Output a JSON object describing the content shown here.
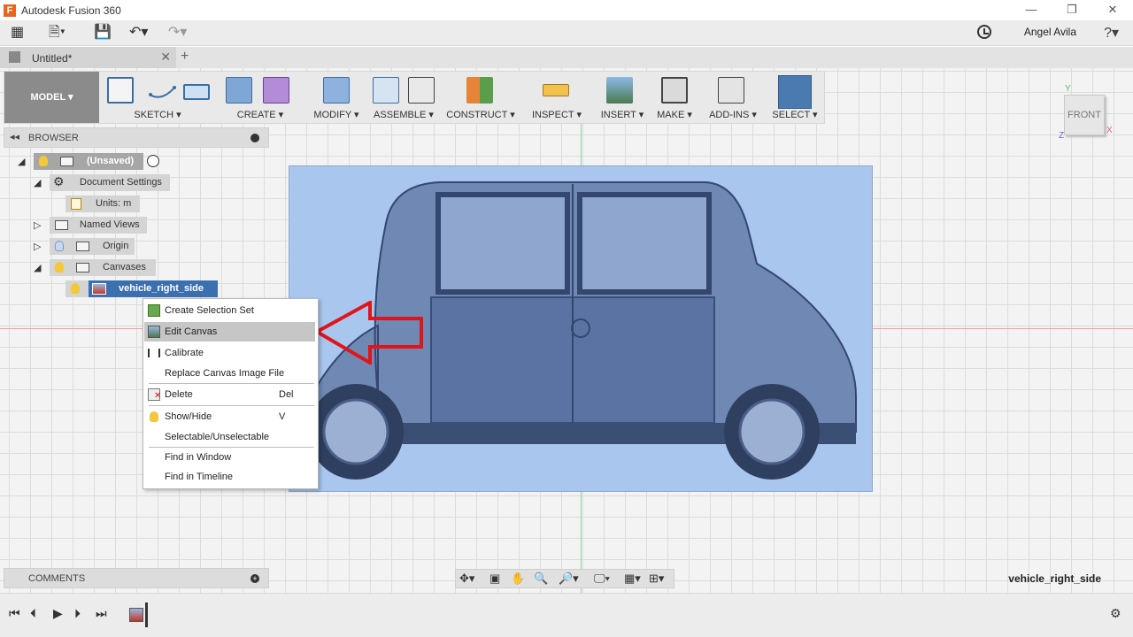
{
  "window": {
    "app_title": "Autodesk Fusion 360",
    "logo": "F"
  },
  "quick_access": {
    "user": "Angel Avila"
  },
  "tabs": {
    "doc_tab": "Untitled*"
  },
  "toolbar": {
    "model": "MODEL",
    "groups": [
      "SKETCH",
      "CREATE",
      "MODIFY",
      "ASSEMBLE",
      "CONSTRUCT",
      "INSPECT",
      "INSERT",
      "MAKE",
      "ADD-INS",
      "SELECT"
    ]
  },
  "viewcube": {
    "face": "FRONT",
    "x": "X",
    "y": "Y",
    "z": "Z"
  },
  "browser": {
    "title": "BROWSER",
    "root": "(Unsaved)",
    "nodes": {
      "document_settings": "Document Settings",
      "units": "Units: m",
      "named_views": "Named Views",
      "origin": "Origin",
      "canvases": "Canvases",
      "canvas_item": "vehicle_right_side"
    }
  },
  "context_menu": {
    "items": [
      {
        "label": "Create Selection Set",
        "shortcut": ""
      },
      {
        "label": "Edit Canvas",
        "shortcut": ""
      },
      {
        "label": "Calibrate",
        "shortcut": ""
      },
      {
        "label": "Replace Canvas Image File",
        "shortcut": ""
      },
      {
        "label": "Delete",
        "shortcut": "Del"
      },
      {
        "label": "Show/Hide",
        "shortcut": "V"
      },
      {
        "label": "Selectable/Unselectable",
        "shortcut": ""
      },
      {
        "label": "Find in Window",
        "shortcut": ""
      },
      {
        "label": "Find in Timeline",
        "shortcut": ""
      }
    ],
    "highlighted": "Edit Canvas"
  },
  "comments": {
    "title": "COMMENTS"
  },
  "status": {
    "canvas_name": "vehicle_right_side"
  },
  "colors": {
    "accent_blue": "#4a7ab0",
    "arrow_red": "#e0151b",
    "canvas_tint": "#a9c6ee"
  }
}
